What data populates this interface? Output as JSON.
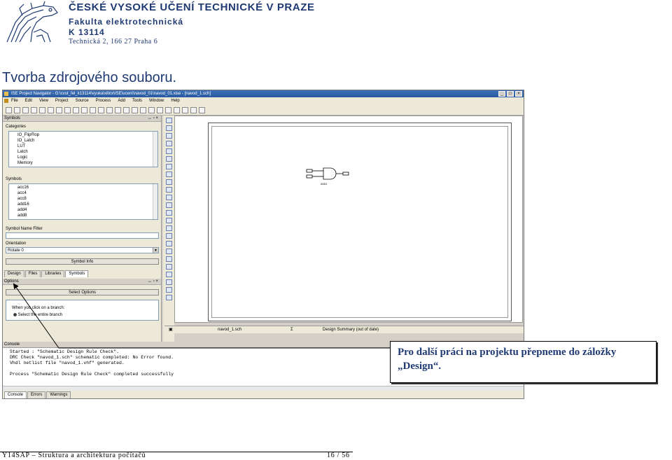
{
  "header": {
    "university": "ČESKÉ VYSOKÉ UČENÍ TECHNICKÉ V PRAZE",
    "faculty": "Fakulta elektrotechnická",
    "department": "K 13114",
    "address": "Technická 2, 166 27 Praha 6"
  },
  "slide_title": "Tvorba zdrojového souboru.",
  "ise": {
    "title": "ISE Project Navigator - G:\\cvut_fel_k13114\\vyuka\\xilinx\\ISE\\ucení\\navod_01\\navod_01.xise - [navod_1.sch]",
    "menu": [
      "File",
      "Edit",
      "View",
      "Project",
      "Source",
      "Process",
      "Add",
      "Tools",
      "Window",
      "Help"
    ],
    "symbols_panel": {
      "header": "Symbols",
      "categories_label": "Categories",
      "categories": [
        "IO_FlipFlop",
        "IO_Latch",
        "LUT",
        "Latch",
        "Logic",
        "Memory"
      ],
      "symbols_label": "Symbols",
      "symbols": [
        "acc16",
        "acc4",
        "acc8",
        "add16",
        "add4",
        "add8"
      ],
      "name_filter_label": "Symbol Name Filter",
      "orientation_label": "Orientation",
      "orientation_value": "Rotate 0",
      "symbol_info_button": "Symbol Info",
      "tabs": [
        "Design",
        "Files",
        "Libraries",
        "Symbols"
      ]
    },
    "options_panel": {
      "header": "Options",
      "select_options_button": "Select Options",
      "branch_label": "When you click on a branch:",
      "branch_option": "Select the entire branch"
    },
    "gate_label": "AND2",
    "doc_tabs": [
      "navod_1.sch",
      "Design Summary (out of date)"
    ],
    "console": {
      "header": "Console",
      "lines": [
        "Started : \"Schematic Design Rule Check\".",
        "DRC Check \"navod_1.sch\" schematic completed: No Error found.",
        "Vhdl netlist file \"navod_1.vhf\" generated.",
        "",
        "Process \"Schematic Design Rule Check\" completed successfully"
      ],
      "tabs": [
        "Console",
        "Errors",
        "Warnings"
      ]
    }
  },
  "callout": {
    "line1": "Pro další práci na projektu přepneme do záložky",
    "line2": "„Design“."
  },
  "footer": {
    "left": "Y14SAP – Struktura a architektura počítačů",
    "page": "16 / 56"
  },
  "colors": {
    "brand_blue": "#1f3a73",
    "titlebar": "#2a5aa0"
  }
}
